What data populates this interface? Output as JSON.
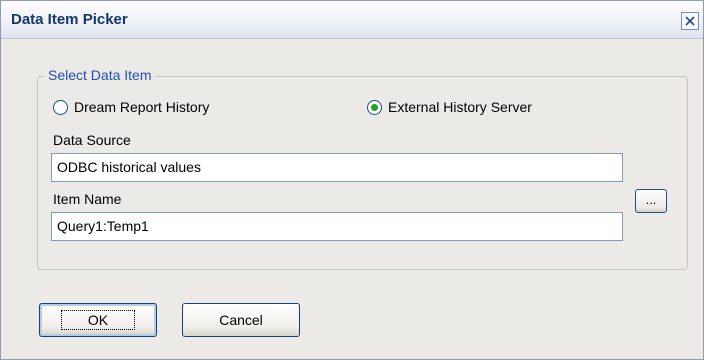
{
  "window": {
    "title": "Data Item Picker",
    "close_symbol": "✕"
  },
  "group": {
    "legend": "Select Data Item",
    "radio_options": [
      {
        "label": "Dream Report History",
        "selected": false
      },
      {
        "label": "External History Server",
        "selected": true
      }
    ],
    "data_source": {
      "label": "Data Source",
      "value": "ODBC historical values"
    },
    "item_name": {
      "label": "Item Name",
      "value": "Query1:Temp1"
    },
    "browse_label": "..."
  },
  "buttons": {
    "ok_label": "OK",
    "cancel_label": "Cancel"
  },
  "colors": {
    "title_text": "#14376b",
    "legend_text": "#1f4fb5",
    "radio_selected": "#21a121",
    "dialog_bg": "#eceae6"
  },
  "icons": {
    "close": "close-icon",
    "radio_selected": "radio-selected-icon",
    "radio_unselected": "radio-unselected-icon"
  }
}
